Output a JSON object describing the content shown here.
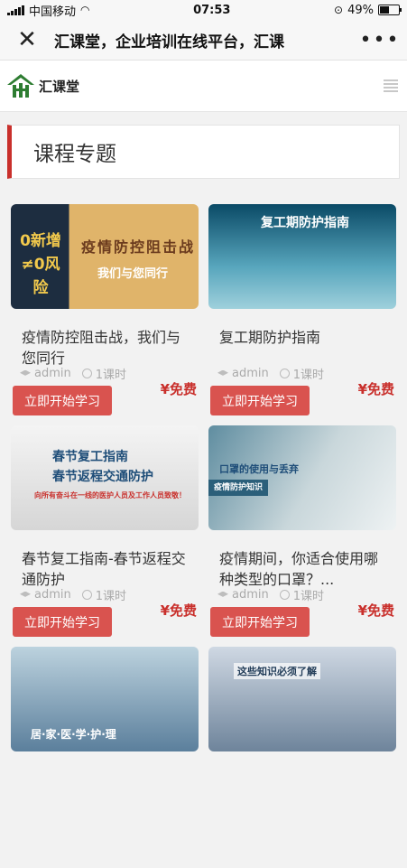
{
  "status": {
    "carrier": "中国移动",
    "time": "07:53",
    "battery": "49%",
    "battery_level": 0.49
  },
  "nav": {
    "close": "✕",
    "title": "汇课堂，企业培训在线平台，汇课",
    "more": "•••"
  },
  "header": {
    "logo_text": "汇课堂"
  },
  "section": {
    "title": "课程专题"
  },
  "colors": {
    "accent": "#c9302c",
    "button": "#d9534f"
  },
  "courses": [
    {
      "title": "疫情防控阻击战，我们与您同行",
      "author": "admin",
      "lessons": "1课时",
      "price": "¥免费",
      "button": "立即开始学习",
      "thumb_big": "0新增≠0风险",
      "thumb_main": "疫情防控阻击战",
      "thumb_sub": "我们与您同行"
    },
    {
      "title": "复工期防护指南",
      "author": "admin",
      "lessons": "1课时",
      "price": "¥免费",
      "button": "立即开始学习",
      "thumb_main": "复工期防护指南"
    },
    {
      "title": "春节复工指南-春节返程交通防护",
      "author": "admin",
      "lessons": "1课时",
      "price": "¥免费",
      "button": "立即开始学习",
      "thumb_main": "春节复工指南",
      "thumb_sub": "春节返程交通防护",
      "thumb_small": "向所有奋斗在一线的医护人员及工作人员致敬！"
    },
    {
      "title": "疫情期间，你适合使用哪种类型的口罩？...",
      "author": "admin",
      "lessons": "1课时",
      "price": "¥免费",
      "button": "立即开始学习",
      "thumb_main": "口罩的使用与丢弃",
      "thumb_sub": "疫情防护知识"
    },
    {
      "thumb_main": "居·家·医·学·护·理"
    },
    {
      "thumb_main": "这些知识必须了解"
    }
  ]
}
